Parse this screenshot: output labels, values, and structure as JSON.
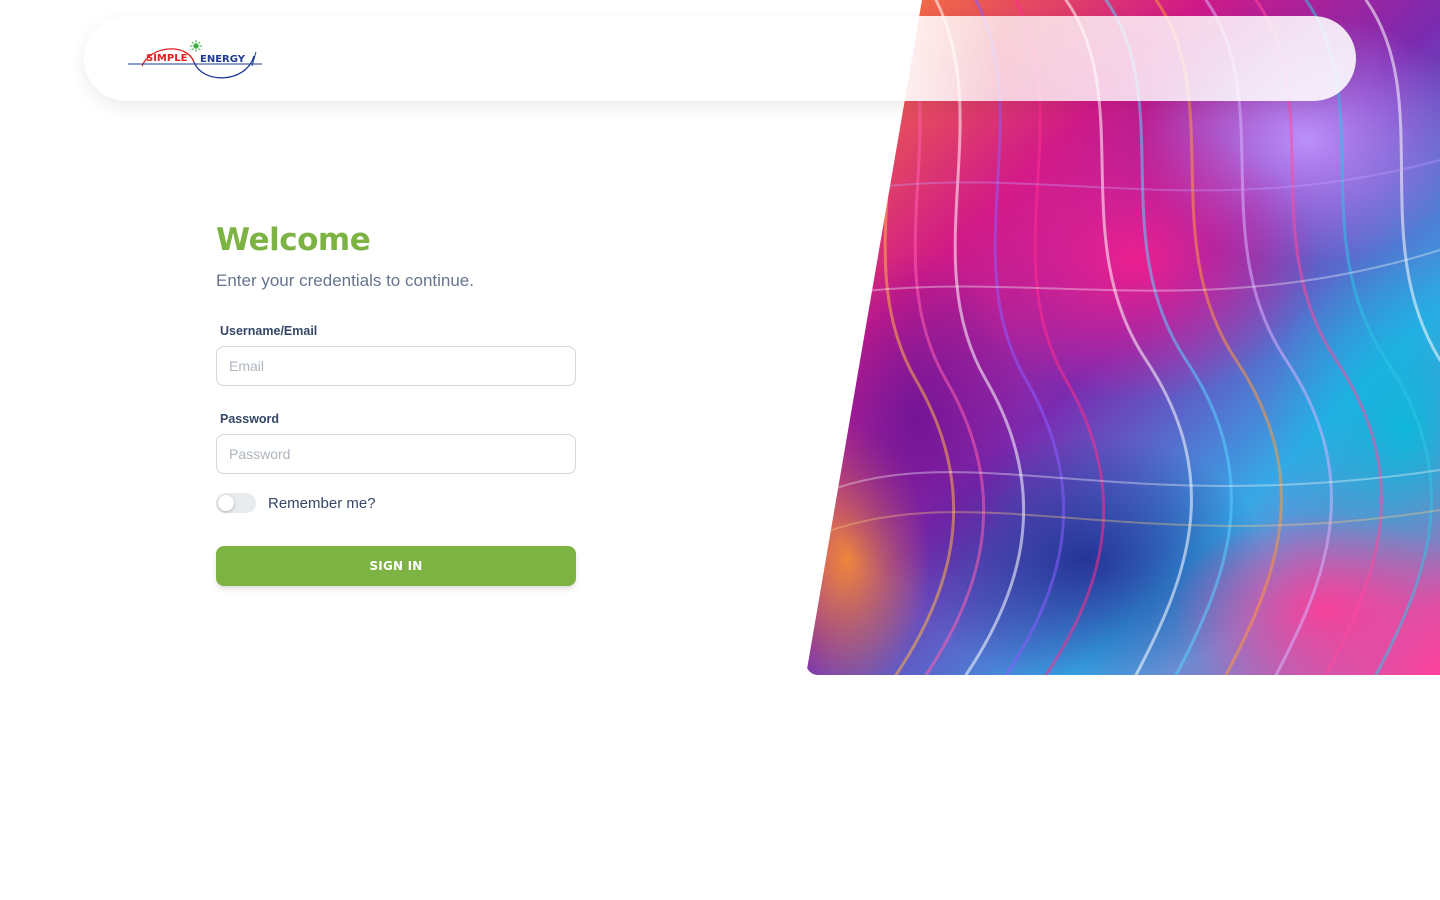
{
  "brand": {
    "logo_word_1": "SIMPLE",
    "logo_word_2": "ENERGY",
    "colors": {
      "red": "#e02020",
      "blue": "#1f3a93",
      "green": "#3cb043"
    }
  },
  "login": {
    "title": "Welcome",
    "subtitle": "Enter your credentials to continue.",
    "username_label": "Username/Email",
    "username_placeholder": "Email",
    "username_value": "",
    "password_label": "Password",
    "password_placeholder": "Password",
    "password_value": "",
    "remember_label": "Remember me?",
    "remember_checked": false,
    "submit_label": "SIGN IN"
  },
  "theme": {
    "accent": "#7cb342",
    "label_color": "#344767",
    "muted_text": "#67748e"
  },
  "decor": {
    "icon": "abstract-swirl-art"
  }
}
